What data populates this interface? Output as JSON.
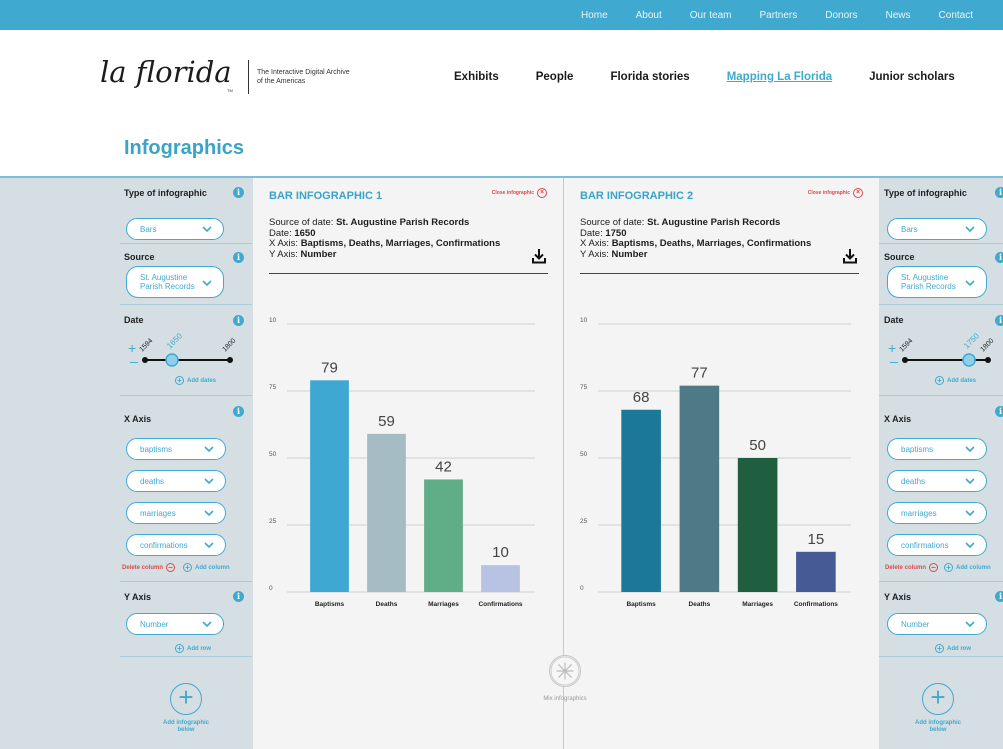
{
  "topnav": [
    "Home",
    "About",
    "Our team",
    "Partners",
    "Donors",
    "News",
    "Contact"
  ],
  "logo": {
    "text": "la florida",
    "tm": "TM",
    "tagline": "The Interactive Digital Archive of the Americas"
  },
  "mainnav": [
    {
      "label": "Exhibits",
      "active": false
    },
    {
      "label": "People",
      "active": false
    },
    {
      "label": "Florida stories",
      "active": false
    },
    {
      "label": "Mapping La Florida",
      "active": true
    },
    {
      "label": "Junior scholars",
      "active": false
    }
  ],
  "page_title": "Infographics",
  "sidebar": {
    "type_label": "Type of infographic",
    "type_value": "Bars",
    "source_label": "Source",
    "source_value_line1": "St. Augustine",
    "source_value_line2": "Parish Records",
    "date_label": "Date",
    "date_min": "1594",
    "date_max": "1800",
    "add_dates": "Add dates",
    "xaxis_label": "X Axis",
    "xaxis_values": [
      "baptisms",
      "deaths",
      "marriages",
      "confirmations"
    ],
    "delete_column": "Delete column",
    "add_column": "Add column",
    "yaxis_label": "Y Axis",
    "yaxis_value": "Number",
    "add_row": "Add row",
    "add_infographic_line1": "Add infographic",
    "add_infographic_line2": "below"
  },
  "sidebars": [
    {
      "date_selected": "1650"
    },
    {
      "date_selected": "1750"
    }
  ],
  "panels": [
    {
      "title": "BAR INFOGRAPHIC 1",
      "close_label": "Close infographic",
      "source_prefix": "Source of date: ",
      "source": "St. Augustine Parish Records",
      "date_prefix": "Date: ",
      "date": "1650",
      "xaxis_prefix": "X Axis: ",
      "xaxis": "Baptisms, Deaths, Marriages, Confirmations",
      "yaxis_prefix": "Y Axis: ",
      "yaxis": "Number"
    },
    {
      "title": "BAR INFOGRAPHIC 2",
      "close_label": "Close infographic",
      "source_prefix": "Source of date: ",
      "source": "St. Augustine Parish Records",
      "date_prefix": "Date: ",
      "date": "1750",
      "xaxis_prefix": "X Axis: ",
      "xaxis": "Baptisms, Deaths, Marriages, Confirmations",
      "yaxis_prefix": "Y Axis: ",
      "yaxis": "Number"
    }
  ],
  "mix_label": "Mix infographics",
  "colors": {
    "accent": "#3fa9cf",
    "danger": "#d94a4a",
    "bars1": [
      "#3ea8d2",
      "#a6bcc4",
      "#5fae88",
      "#b8c3e3"
    ],
    "bars2": [
      "#1c7897",
      "#4e7a85",
      "#1f5e3f",
      "#465b95"
    ]
  },
  "chart_data": [
    {
      "type": "bar",
      "categories": [
        "Baptisms",
        "Deaths",
        "Marriages",
        "Confirmations"
      ],
      "values": [
        79,
        59,
        42,
        10
      ],
      "yticks": [
        "0",
        "25",
        "50",
        "75",
        "10"
      ],
      "ylim": [
        0,
        100
      ],
      "grid": true
    },
    {
      "type": "bar",
      "categories": [
        "Baptisms",
        "Deaths",
        "Marriages",
        "Confirmations"
      ],
      "values": [
        68,
        77,
        50,
        15
      ],
      "yticks": [
        "0",
        "25",
        "50",
        "75",
        "10"
      ],
      "ylim": [
        0,
        100
      ],
      "grid": true
    }
  ]
}
